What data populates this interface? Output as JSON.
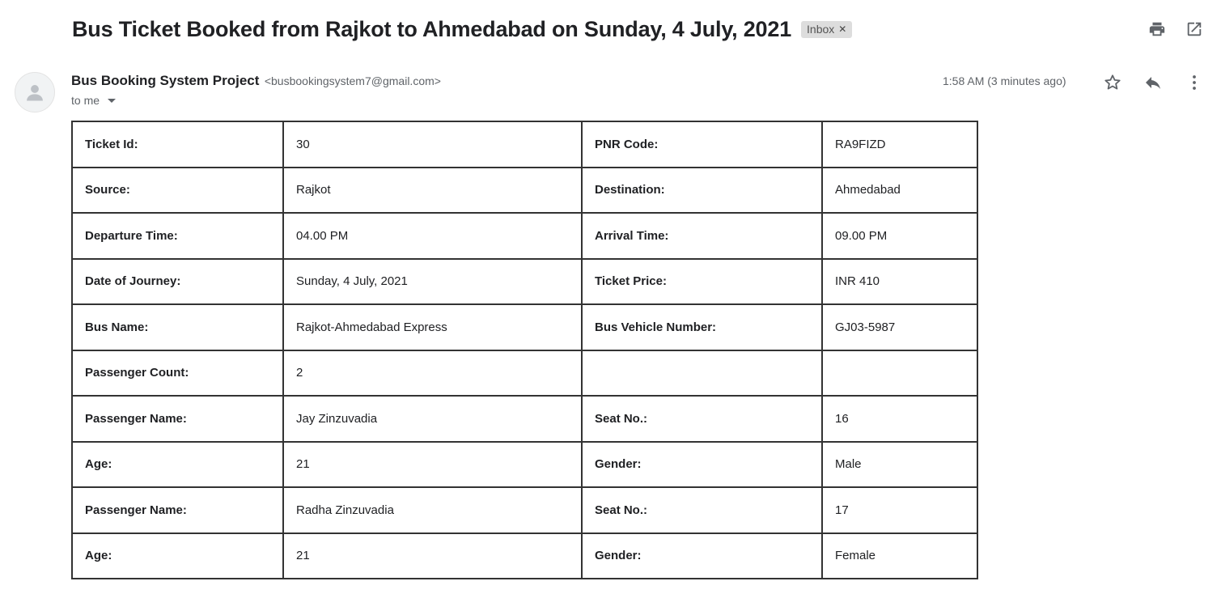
{
  "email": {
    "subject": "Bus Ticket Booked from Rajkot to Ahmedabad on Sunday, 4 July, 2021",
    "label": "Inbox",
    "sender_name": "Bus Booking System Project",
    "sender_email": "<busbookingsystem7@gmail.com>",
    "recipient": "to me",
    "timestamp": "1:58 AM (3 minutes ago)"
  },
  "icons": {
    "top": [
      "print-icon",
      "open-in-new-window-icon"
    ],
    "message": [
      "star-icon",
      "reply-icon",
      "more-vert-icon"
    ],
    "avatar": "default-avatar-icon"
  },
  "ticket": {
    "rows": [
      [
        "Ticket Id:",
        "30",
        "PNR Code:",
        "RA9FIZD"
      ],
      [
        "Source:",
        "Rajkot",
        "Destination:",
        "Ahmedabad"
      ],
      [
        "Departure Time:",
        "04.00 PM",
        "Arrival Time:",
        "09.00 PM"
      ],
      [
        "Date of Journey:",
        "Sunday, 4 July, 2021",
        "Ticket Price:",
        "INR 410"
      ],
      [
        "Bus Name:",
        "Rajkot-Ahmedabad Express",
        "Bus Vehicle Number:",
        "GJ03-5987"
      ],
      [
        "Passenger Count:",
        "2",
        "",
        ""
      ],
      [
        "Passenger Name:",
        "Jay Zinzuvadia",
        "Seat No.:",
        "16"
      ],
      [
        "Age:",
        "21",
        "Gender:",
        "Male"
      ],
      [
        "Passenger Name:",
        "Radha Zinzuvadia",
        "Seat No.:",
        "17"
      ],
      [
        "Age:",
        "21",
        "Gender:",
        "Female"
      ]
    ]
  },
  "colors": {
    "text": "#202124",
    "muted": "#5f6368",
    "chip_bg": "#dddddd",
    "table_border": "#333333"
  }
}
